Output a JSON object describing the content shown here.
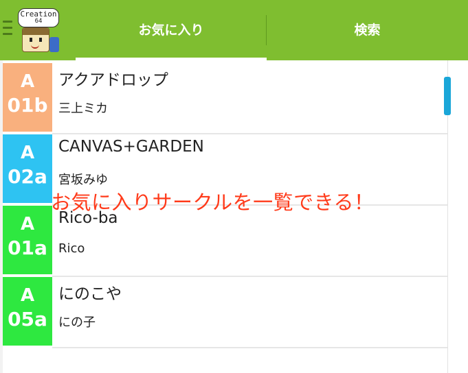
{
  "logo": {
    "line1": "Creation",
    "line2": "64"
  },
  "tabs": [
    {
      "label": "お気に入り",
      "selected": true
    },
    {
      "label": "検索",
      "selected": false
    }
  ],
  "circles": [
    {
      "hall": "A",
      "number": "01b",
      "color": "#f9b07e",
      "name": "アクアドロップ",
      "author": "三上ミカ"
    },
    {
      "hall": "A",
      "number": "02a",
      "color": "#2ec3f2",
      "name": "CANVAS+GARDEN",
      "author": "宮坂みゆ"
    },
    {
      "hall": "A",
      "number": "01a",
      "color": "#2ee840",
      "name": "Rico-ba",
      "author": "Rico"
    },
    {
      "hall": "A",
      "number": "05a",
      "color": "#2ee840",
      "name": "にのこや",
      "author": "にの子"
    }
  ],
  "overlay_caption": "お気に入りサークルを一覧できる！",
  "colors": {
    "appbar": "#7fbe30",
    "scrollbar": "#1aa6d8",
    "caption": "#ff3a1a"
  }
}
